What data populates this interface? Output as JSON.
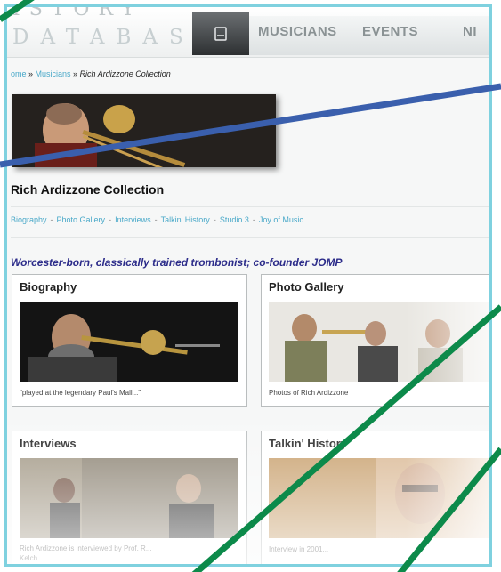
{
  "site": {
    "logo_top": "ISTORY",
    "logo_bottom": "DATABASE"
  },
  "nav": {
    "items": [
      {
        "label": "MUSICIANS"
      },
      {
        "label": "EVENTS"
      },
      {
        "label": "NI"
      }
    ]
  },
  "breadcrumb": {
    "home": "ome",
    "sep1": " » ",
    "musicians": "Musicians",
    "sep2": " » ",
    "current": "Rich Ardizzone Collection"
  },
  "page": {
    "title": "Rich Ardizzone Collection",
    "tagline": "Worcester-born, classically trained trombonist; co-founder JOMP"
  },
  "subnav": {
    "items": [
      {
        "label": "Biography"
      },
      {
        "label": "Photo Gallery"
      },
      {
        "label": "Interviews"
      },
      {
        "label": "Talkin' History"
      },
      {
        "label": "Studio 3"
      },
      {
        "label": "Joy of Music"
      }
    ],
    "separator": "-"
  },
  "cards": {
    "biography": {
      "title": "Biography",
      "caption": "\"played at the legendary Paul's Mall...\""
    },
    "photo_gallery": {
      "title": "Photo Gallery",
      "caption": "Photos of Rich Ardizzone"
    },
    "interviews": {
      "title": "Interviews",
      "caption": "Rich Ardizzone is interviewed by Prof. R...",
      "caption2": "Kelch"
    },
    "talkin_history": {
      "title": "Talkin' History",
      "caption": "Interview in 2001..."
    }
  },
  "colors": {
    "frame_border": "#7fd1df",
    "link": "#4aa9c9",
    "tagline": "#2c2c8a",
    "annotation_blue": "#3a5fad",
    "annotation_green": "#0c8a4a"
  },
  "icons": {
    "home_tab": "home-icon"
  }
}
